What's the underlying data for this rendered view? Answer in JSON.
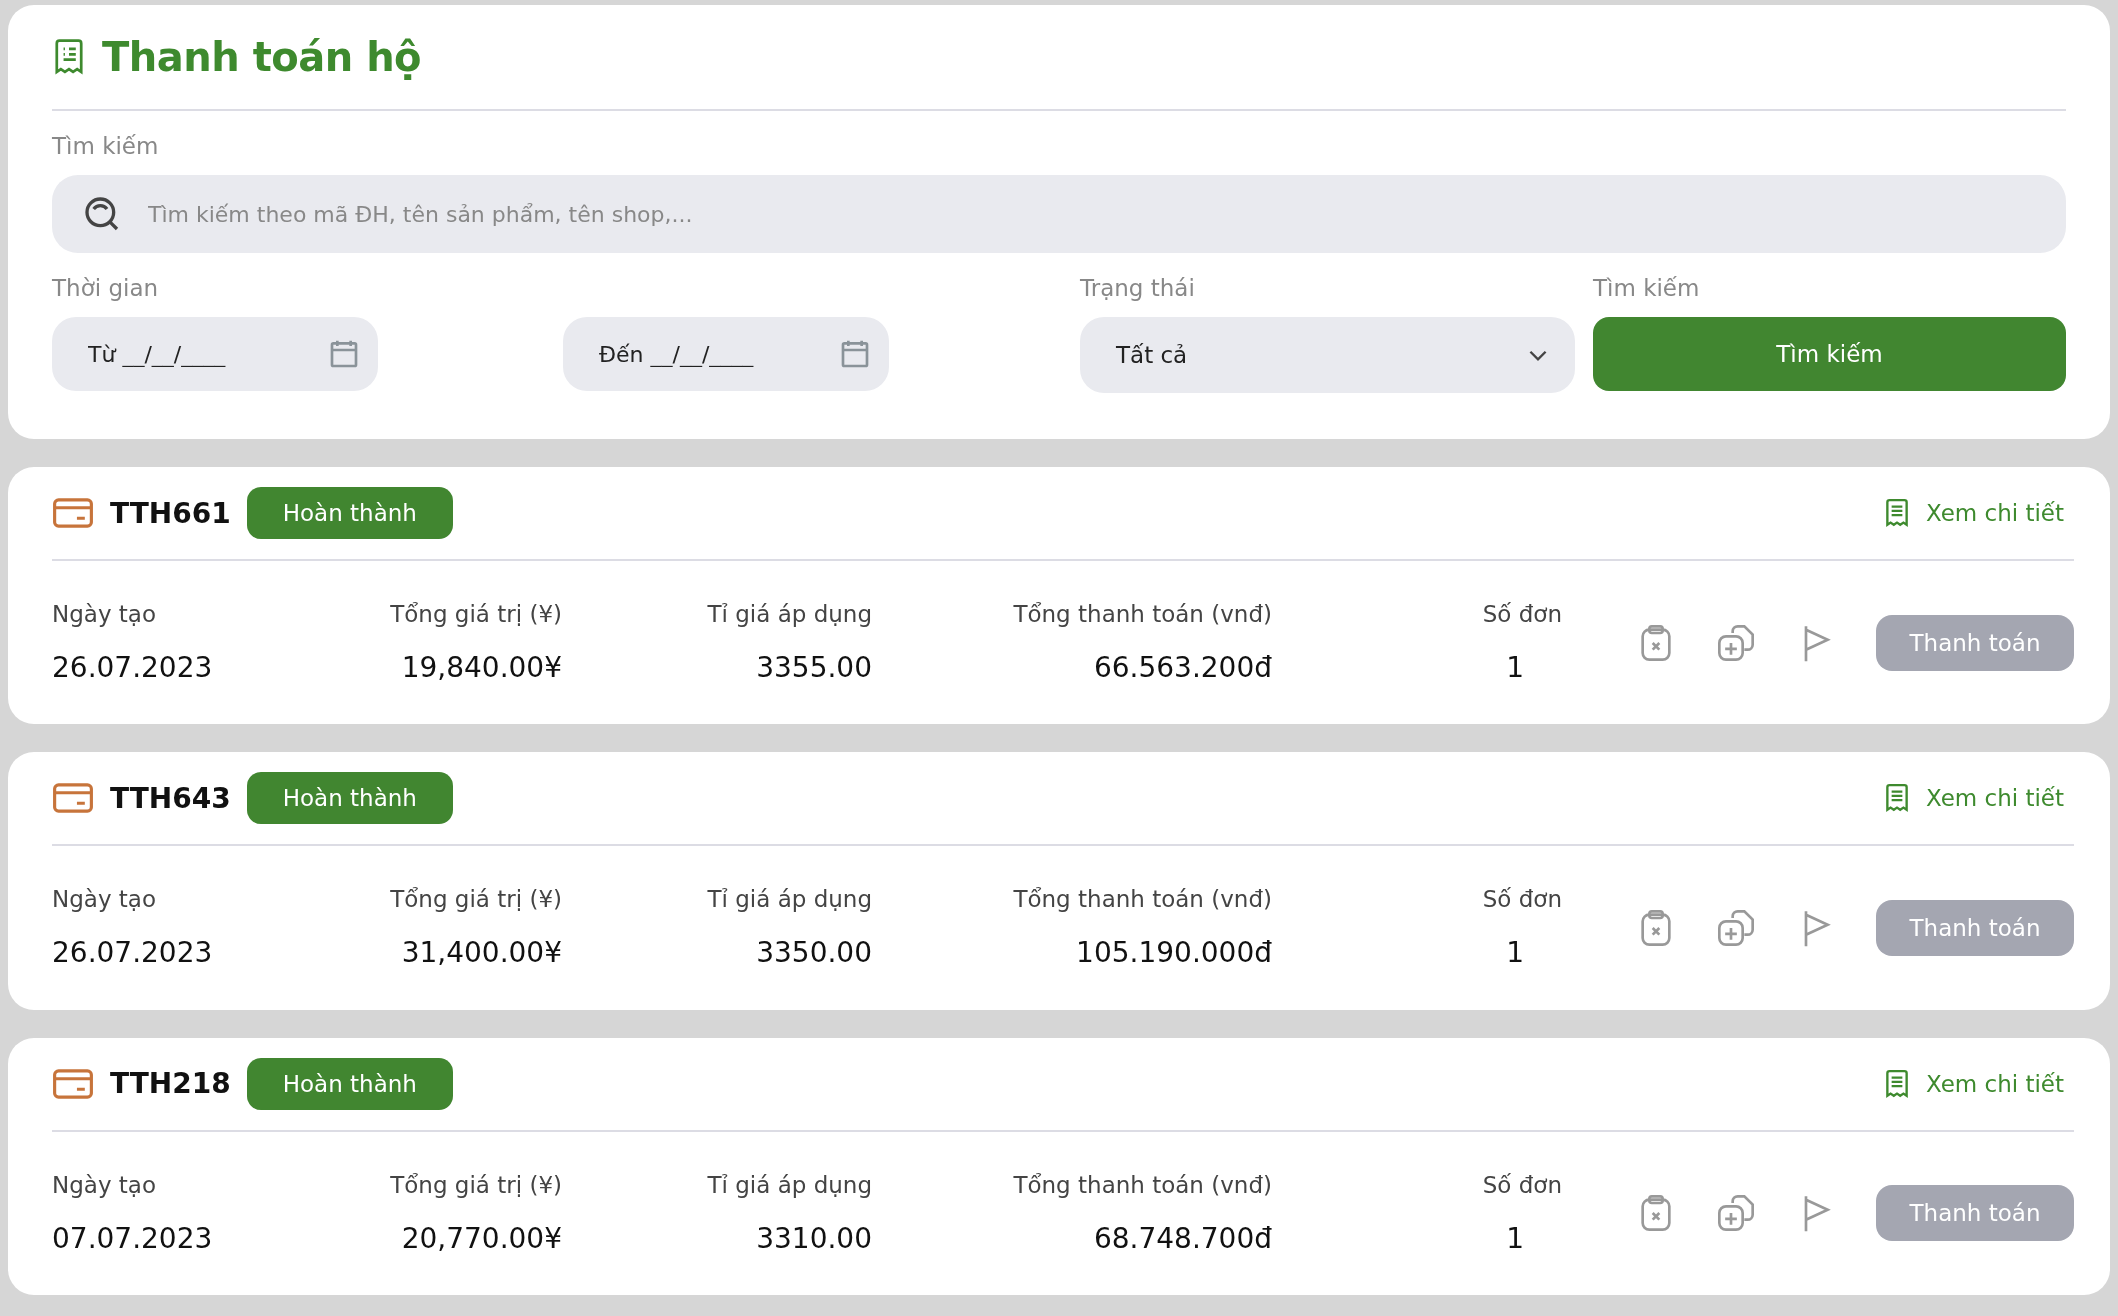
{
  "page": {
    "title": "Thanh toán hộ"
  },
  "filters": {
    "search_label": "Tìm kiếm",
    "search": {
      "placeholder": "Tìm kiếm theo mã ĐH, tên sản phẩm, tên shop,..."
    },
    "time_label": "Thời gian",
    "from": {
      "placeholder": "Từ __/__/____"
    },
    "to": {
      "placeholder": "Đến __/__/____"
    },
    "status_label": "Trạng thái",
    "status": {
      "value": "Tất cả"
    },
    "action_label": "Tìm kiếm",
    "search_button": "Tìm kiếm"
  },
  "orders": [
    {
      "id": "TTH661",
      "status": "Hoàn thành",
      "detail_link": "Xem chi tiết",
      "fields": [
        {
          "label": "Ngày tạo",
          "value": "26.07.2023"
        },
        {
          "label": "Tổng giá trị (¥)",
          "value": "19,840.00¥"
        },
        {
          "label": "Tỉ giá áp dụng",
          "value": "3355.00"
        },
        {
          "label": "Tổng thanh toán (vnđ)",
          "value": "66.563.200đ"
        },
        {
          "label": "Số đơn",
          "value": "1"
        }
      ],
      "pay_button": {
        "label": "Thanh toán",
        "disabled": true
      }
    },
    {
      "id": "TTH643",
      "status": "Hoàn thành",
      "detail_link": "Xem chi tiết",
      "fields": [
        {
          "label": "Ngày tạo",
          "value": "26.07.2023"
        },
        {
          "label": "Tổng giá trị (¥)",
          "value": "31,400.00¥"
        },
        {
          "label": "Tỉ giá áp dụng",
          "value": "3350.00"
        },
        {
          "label": "Tổng thanh toán (vnđ)",
          "value": "105.190.000đ"
        },
        {
          "label": "Số đơn",
          "value": "1"
        }
      ],
      "pay_button": {
        "label": "Thanh toán",
        "disabled": true
      }
    },
    {
      "id": "TTH218",
      "status": "Hoàn thành",
      "detail_link": "Xem chi tiết",
      "fields": [
        {
          "label": "Ngày tạo",
          "value": "07.07.2023"
        },
        {
          "label": "Tổng giá trị (¥)",
          "value": "20,770.00¥"
        },
        {
          "label": "Tỉ giá áp dụng",
          "value": "3310.00"
        },
        {
          "label": "Tổng thanh toán (vnđ)",
          "value": "68.748.700đ"
        },
        {
          "label": "Số đơn",
          "value": "1"
        }
      ],
      "pay_button": {
        "label": "Thanh toán",
        "disabled": true
      }
    }
  ]
}
